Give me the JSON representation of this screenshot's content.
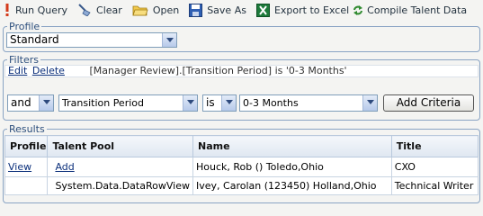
{
  "toolbar": {
    "run_query": "Run Query",
    "clear": "Clear",
    "open": "Open",
    "save_as": "Save As",
    "export_excel": "Export to Excel",
    "compile": "Compile Talent Data"
  },
  "profile": {
    "legend": "Profile",
    "selected": "Standard"
  },
  "filters": {
    "legend": "Filters",
    "edit": "Edit",
    "delete": "Delete",
    "expression": "[Manager Review].[Transition Period] is '0-3 Months'",
    "conjunction": "and",
    "field": "Transition Period",
    "operator": "is",
    "value": "0-3 Months",
    "add_button": "Add Criteria"
  },
  "results": {
    "legend": "Results",
    "columns": [
      "Profile",
      "Talent Pool",
      "Name",
      "Title"
    ],
    "rows": [
      [
        "View",
        "Add",
        "Houck, Rob () Toledo,Ohio",
        "CXO"
      ],
      [
        "",
        "System.Data.DataRowView",
        "Ivey, Carolan (123450) Holland,Ohio",
        "Technical Writer"
      ]
    ]
  },
  "colors": {
    "accent": "#2d4f7d",
    "border": "#8aa4c4",
    "link": "#0b2f7b"
  }
}
